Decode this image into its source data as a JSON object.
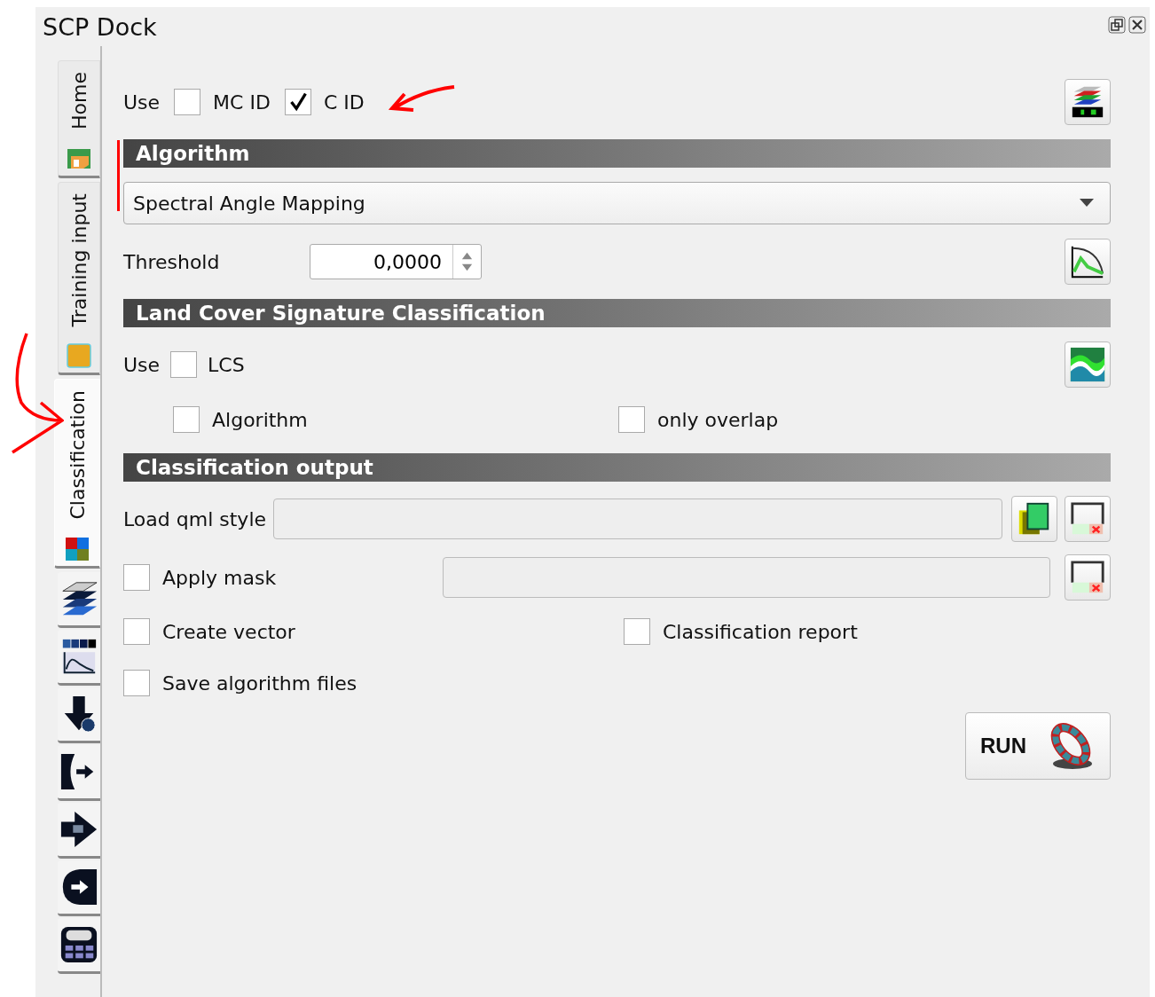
{
  "window": {
    "title": "SCP Dock"
  },
  "tabs": [
    {
      "kind": "text",
      "label": "Home",
      "selected": false
    },
    {
      "kind": "text",
      "label": "Training input",
      "selected": false
    },
    {
      "kind": "text",
      "label": "Classification",
      "selected": true
    },
    {
      "kind": "icon",
      "selected": false
    },
    {
      "kind": "icon",
      "selected": false
    },
    {
      "kind": "icon",
      "selected": false
    },
    {
      "kind": "icon",
      "selected": false
    },
    {
      "kind": "icon",
      "selected": false
    },
    {
      "kind": "icon",
      "selected": false
    },
    {
      "kind": "icon",
      "selected": false
    }
  ],
  "use_row": {
    "use_label": "Use",
    "mc_id": {
      "label": "MC ID",
      "checked": false
    },
    "c_id": {
      "label": "C ID",
      "checked": true
    }
  },
  "algorithm": {
    "header": "Algorithm",
    "value": "Spectral Angle Mapping",
    "threshold_label": "Threshold",
    "threshold_value": "0,0000"
  },
  "lcs": {
    "header": "Land Cover Signature Classification",
    "use_label": "Use",
    "lcs": {
      "label": "LCS",
      "checked": false
    },
    "algorithm": {
      "label": "Algorithm",
      "checked": false
    },
    "only_overlap": {
      "label": "only overlap",
      "checked": false
    }
  },
  "output": {
    "header": "Classification output",
    "qml_label": "Load qml style",
    "apply_mask": {
      "label": "Apply mask",
      "checked": false
    },
    "create_vector": {
      "label": "Create vector",
      "checked": false
    },
    "classification_report": {
      "label": "Classification report",
      "checked": false
    },
    "save_algorithm_files": {
      "label": "Save algorithm files",
      "checked": false
    },
    "run_label": "RUN"
  }
}
